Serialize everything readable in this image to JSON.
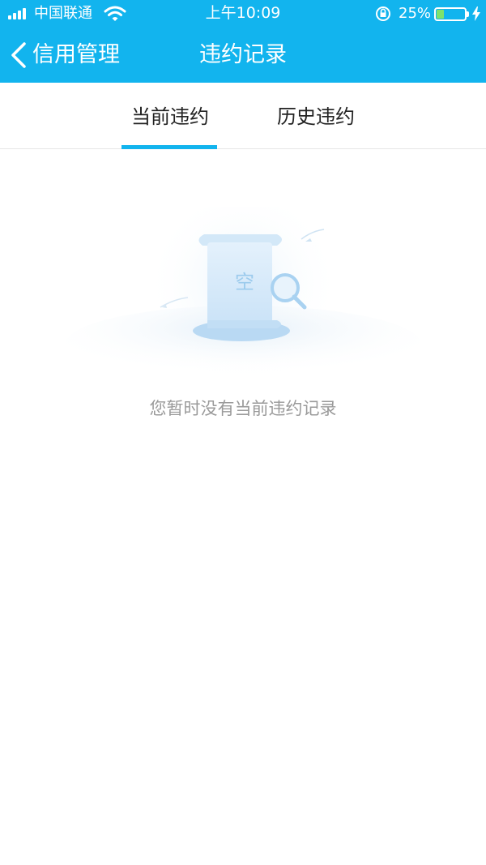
{
  "status_bar": {
    "carrier": "中国联通",
    "time": "上午10:09",
    "battery_percent": "25%",
    "battery_level": 0.25,
    "signal_bars": 4
  },
  "nav": {
    "back_label": "信用管理",
    "title": "违约记录"
  },
  "tabs": [
    {
      "label": "当前违约",
      "active": true
    },
    {
      "label": "历史违约",
      "active": false
    }
  ],
  "empty_state": {
    "illustration_text": "空",
    "message": "您暂时没有当前违约记录"
  },
  "colors": {
    "primary": "#12b4ee",
    "battery": "#7ee26b",
    "muted_text": "#9a9a9a"
  }
}
